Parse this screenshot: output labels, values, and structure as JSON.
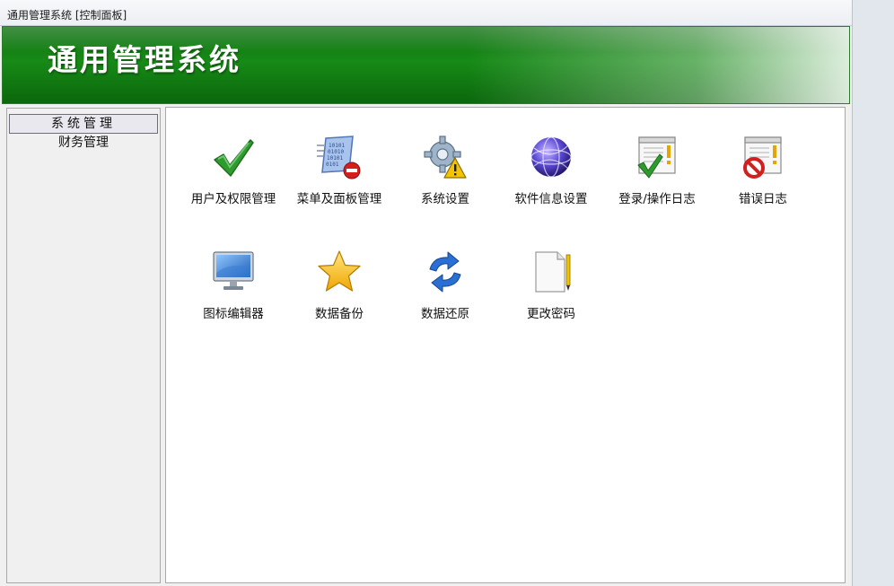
{
  "window": {
    "title": "通用管理系统 [控制面板]"
  },
  "banner": {
    "title": "通用管理系统"
  },
  "sidebar": {
    "items": [
      {
        "label": "系统管理",
        "active": true
      },
      {
        "label": "财务管理",
        "active": false
      }
    ]
  },
  "tiles": [
    {
      "label": "用户及权限管理",
      "icon": "checkmark-icon"
    },
    {
      "label": "菜单及面板管理",
      "icon": "binary-document-no-entry-icon"
    },
    {
      "label": "系统设置",
      "icon": "gear-warning-icon"
    },
    {
      "label": "软件信息设置",
      "icon": "globe-icon"
    },
    {
      "label": "登录/操作日志",
      "icon": "log-check-icon"
    },
    {
      "label": "错误日志",
      "icon": "log-error-icon"
    },
    {
      "label": "图标编辑器",
      "icon": "monitor-icon"
    },
    {
      "label": "数据备份",
      "icon": "star-icon"
    },
    {
      "label": "数据还原",
      "icon": "refresh-arrows-icon"
    },
    {
      "label": "更改密码",
      "icon": "document-pencil-icon"
    }
  ],
  "colors": {
    "banner_green": "#178a17",
    "accent_blue": "#2a6fd4",
    "warning_yellow": "#f5c400",
    "error_red": "#d41f1f"
  }
}
